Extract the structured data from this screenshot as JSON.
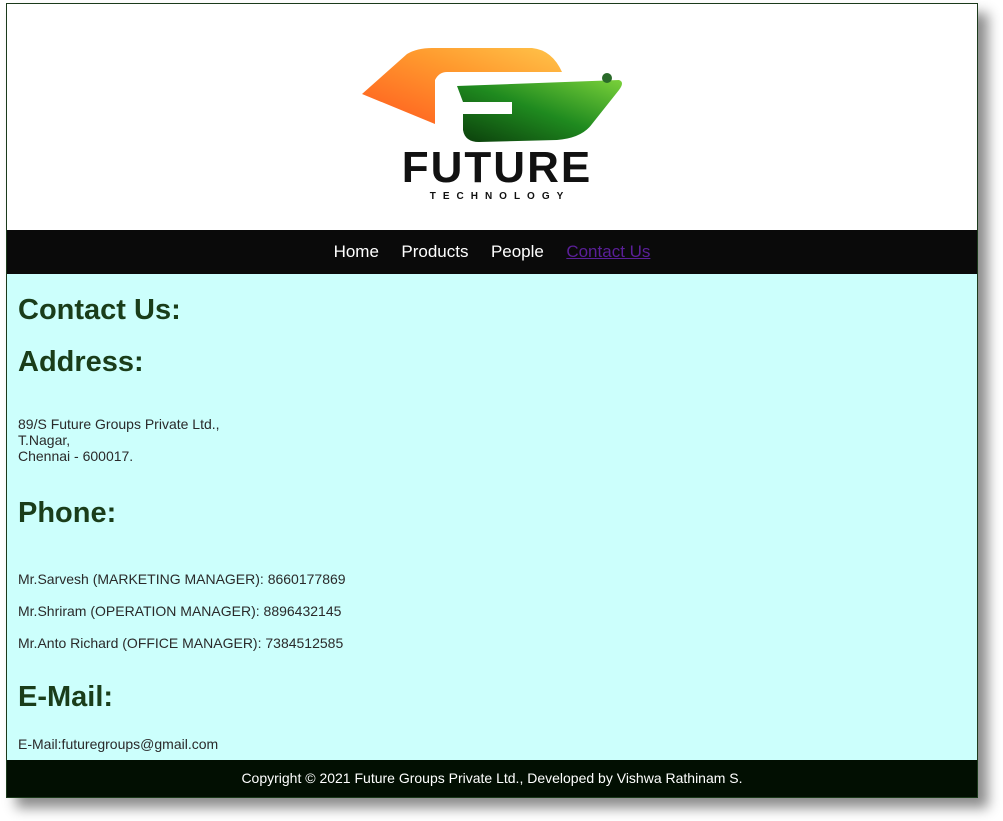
{
  "logo": {
    "name": "FUTURE",
    "tagline": "TECHNOLOGY"
  },
  "nav": {
    "items": [
      {
        "label": "Home"
      },
      {
        "label": "Products"
      },
      {
        "label": "People"
      },
      {
        "label": "Contact Us"
      }
    ],
    "active_color": "#5b1f99"
  },
  "main": {
    "title": "Contact Us:",
    "address_heading": "Address:",
    "address_lines": [
      "89/S Future Groups Private Ltd.,",
      "T.Nagar,",
      "Chennai - 600017."
    ],
    "phone_heading": "Phone:",
    "phones": [
      "Mr.Sarvesh (MARKETING MANAGER): 8660177869",
      "Mr.Shriram (OPERATION MANAGER): 8896432145",
      "Mr.Anto Richard (OFFICE MANAGER): 7384512585"
    ],
    "email_heading": "E-Mail:",
    "email": "E-Mail:futuregroups@gmail.com"
  },
  "footer": {
    "text": "Copyright © 2021 Future Groups Private Ltd., Developed by Vishwa Rathinam S."
  },
  "colors": {
    "content_bg": "#ccfffc",
    "nav_bg": "#0a0a0a",
    "footer_bg": "#020f02",
    "heading": "#1a3d1a"
  }
}
